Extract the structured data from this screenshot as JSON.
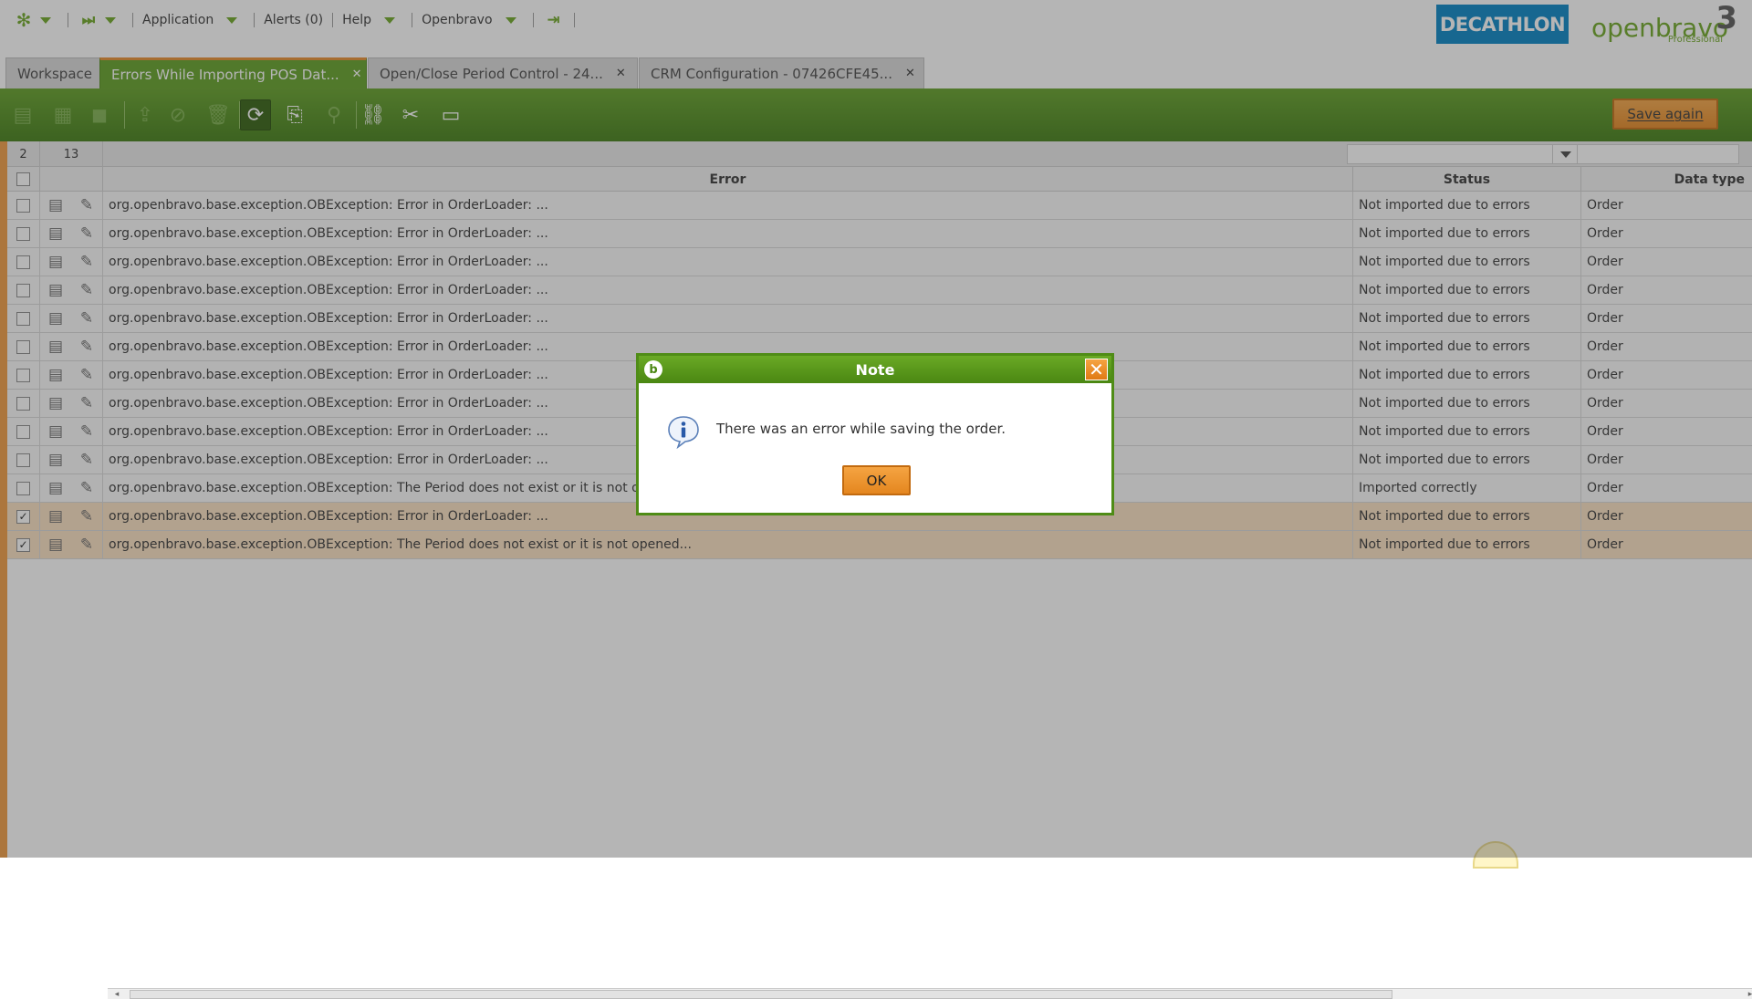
{
  "topmenu": {
    "application": "Application",
    "alerts": "Alerts (0)",
    "help": "Help",
    "openbravo": "Openbravo"
  },
  "logos": {
    "decathlon": "DECATHLON",
    "openbravo_word": "openbravo",
    "openbravo_version": "3",
    "openbravo_edition": "Professional"
  },
  "tabs": [
    {
      "label": "Workspace",
      "active": false,
      "closable": false
    },
    {
      "label": "Errors While Importing POS Dat...",
      "active": true,
      "closable": true
    },
    {
      "label": "Open/Close Period Control - 24...",
      "active": false,
      "closable": true
    },
    {
      "label": "CRM Configuration - 07426CFE45...",
      "active": false,
      "closable": true
    }
  ],
  "toolbar": {
    "save_again_label": "Save again",
    "icons": [
      "new-document-icon",
      "new-row-icon",
      "save-icon",
      "export-icon",
      "cancel-icon",
      "delete-icon",
      "refresh-icon",
      "export-to-file-icon",
      "attachment-icon",
      "link-icon",
      "tools-icon",
      "layout-icon"
    ]
  },
  "grid": {
    "selected_count": "2",
    "total_count": "13",
    "columns": {
      "error": "Error",
      "status": "Status",
      "data_type": "Data type"
    },
    "rows": [
      {
        "error": "org.openbravo.base.exception.OBException: Error in OrderLoader: ...",
        "status": "Not imported due to errors",
        "data_type": "Order",
        "checked": false
      },
      {
        "error": "org.openbravo.base.exception.OBException: Error in OrderLoader: ...",
        "status": "Not imported due to errors",
        "data_type": "Order",
        "checked": false
      },
      {
        "error": "org.openbravo.base.exception.OBException: Error in OrderLoader: ...",
        "status": "Not imported due to errors",
        "data_type": "Order",
        "checked": false
      },
      {
        "error": "org.openbravo.base.exception.OBException: Error in OrderLoader: ...",
        "status": "Not imported due to errors",
        "data_type": "Order",
        "checked": false
      },
      {
        "error": "org.openbravo.base.exception.OBException: Error in OrderLoader: ...",
        "status": "Not imported due to errors",
        "data_type": "Order",
        "checked": false
      },
      {
        "error": "org.openbravo.base.exception.OBException: Error in OrderLoader: ...",
        "status": "Not imported due to errors",
        "data_type": "Order",
        "checked": false
      },
      {
        "error": "org.openbravo.base.exception.OBException: Error in OrderLoader: ...",
        "status": "Not imported due to errors",
        "data_type": "Order",
        "checked": false
      },
      {
        "error": "org.openbravo.base.exception.OBException: Error in OrderLoader: ...",
        "status": "Not imported due to errors",
        "data_type": "Order",
        "checked": false
      },
      {
        "error": "org.openbravo.base.exception.OBException: Error in OrderLoader: ...",
        "status": "Not imported due to errors",
        "data_type": "Order",
        "checked": false
      },
      {
        "error": "org.openbravo.base.exception.OBException: Error in OrderLoader: ...",
        "status": "Not imported due to errors",
        "data_type": "Order",
        "checked": false
      },
      {
        "error": "org.openbravo.base.exception.OBException: The Period does not exist or it is not opened...",
        "status": "Imported correctly",
        "data_type": "Order",
        "checked": false
      },
      {
        "error": "org.openbravo.base.exception.OBException: Error in OrderLoader: ...",
        "status": "Not imported due to errors",
        "data_type": "Order",
        "checked": true
      },
      {
        "error": "org.openbravo.base.exception.OBException: The Period does not exist or it is not opened...",
        "status": "Not imported due to errors",
        "data_type": "Order",
        "checked": true
      }
    ]
  },
  "dialog": {
    "title": "Note",
    "message": "There was an error while saving the order.",
    "ok_label": "OK",
    "close_glyph": "✕"
  },
  "colors": {
    "brand_green": "#5e9e21",
    "accent_orange": "#e98c2b",
    "decathlon_blue": "#0082c3",
    "selected_row": "#fbe0c0"
  }
}
